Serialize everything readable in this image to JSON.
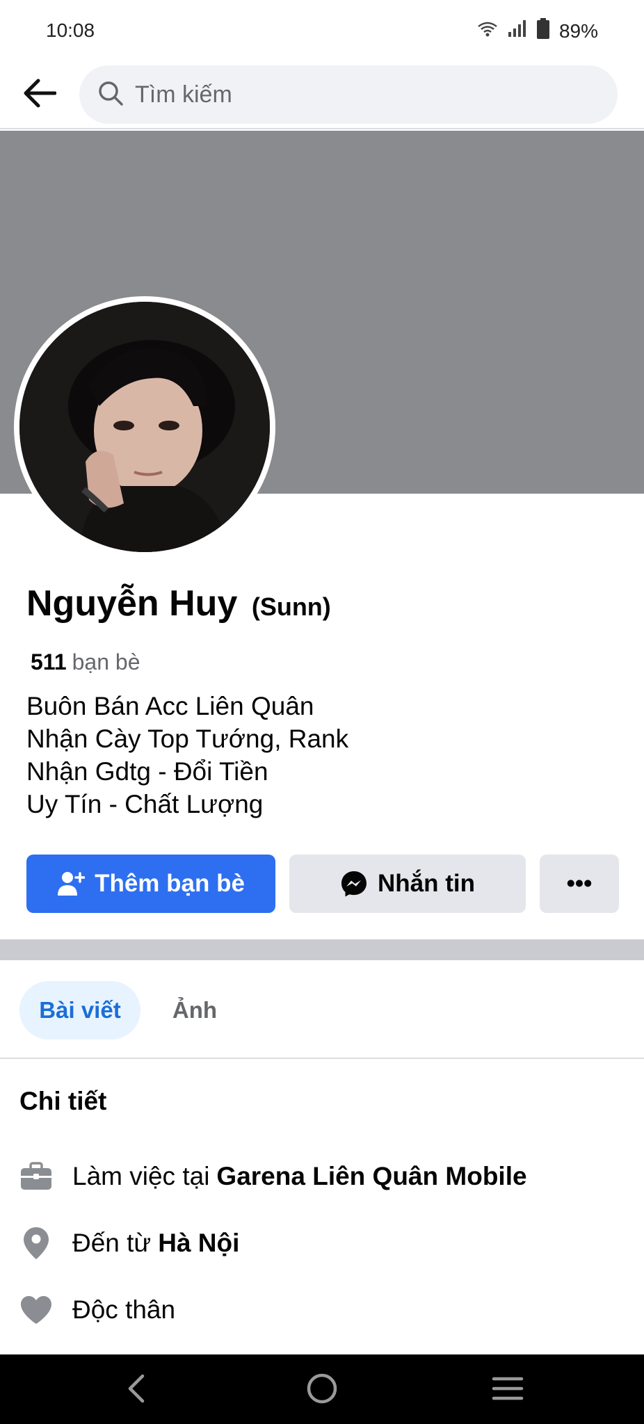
{
  "status_bar": {
    "time": "10:08",
    "battery": "89%"
  },
  "search": {
    "placeholder": "Tìm kiếm"
  },
  "profile": {
    "name": "Nguyễn Huy",
    "nickname": "(Sunn)",
    "friends_count": "511",
    "friends_label": "bạn bè",
    "bio": [
      "Buôn Bán Acc Liên Quân",
      "Nhận Cày Top Tướng, Rank",
      "Nhận Gdtg - Đổi Tiền",
      "Uy Tín - Chất Lượng"
    ]
  },
  "actions": {
    "add_friend": "Thêm bạn bè",
    "message": "Nhắn tin",
    "more": "•••"
  },
  "tabs": {
    "posts": "Bài viết",
    "photos": "Ảnh"
  },
  "details": {
    "title": "Chi tiết",
    "work_prefix": "Làm việc tại",
    "work_place": "Garena Liên Quân Mobile",
    "from_prefix": "Đến từ",
    "from_place": "Hà Nội",
    "relationship": "Độc thân"
  },
  "colors": {
    "accent": "#2d6ff0",
    "cover": "#8a8b8f",
    "tab_active_bg": "#e7f3ff",
    "tab_active_text": "#1b6ed6"
  },
  "icons": {
    "back": "arrow-left-icon",
    "search": "search-icon",
    "add_friend": "person-plus-icon",
    "message": "messenger-icon",
    "work": "briefcase-icon",
    "location": "location-pin-icon",
    "relationship": "heart-icon"
  }
}
